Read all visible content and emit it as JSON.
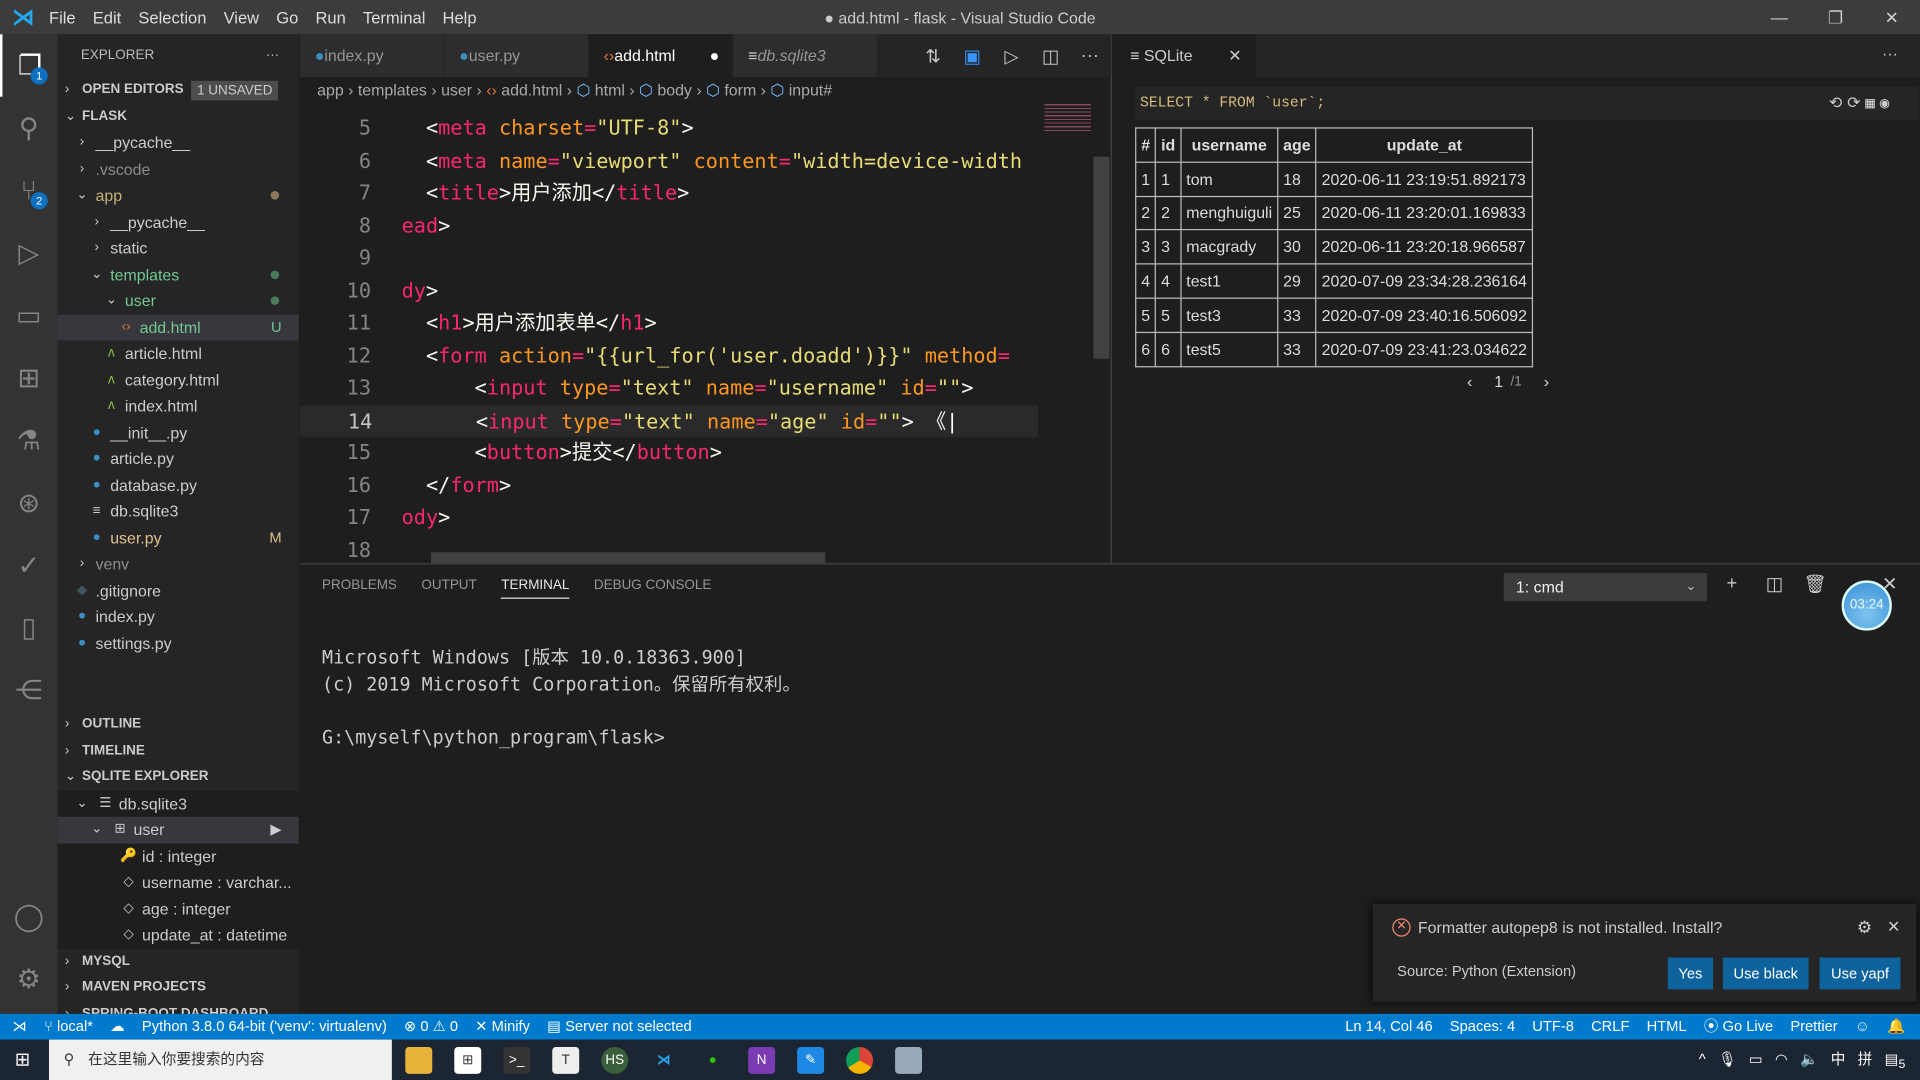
{
  "titlebar": {
    "menu": [
      "File",
      "Edit",
      "Selection",
      "View",
      "Go",
      "Run",
      "Terminal",
      "Help"
    ],
    "title": "● add.html - flask - Visual Studio Code",
    "min": "—",
    "max": "❐",
    "close": "✕"
  },
  "activity": {
    "explorer_badge": "1",
    "scm_badge": "2"
  },
  "sidebar": {
    "title": "EXPLORER",
    "more": "···",
    "open_editors": "OPEN EDITORS",
    "unsaved": "1 UNSAVED",
    "root": "FLASK",
    "tree": [
      {
        "label": "__pycache__",
        "indent": 1,
        "chev": "›",
        "color": "#ccc"
      },
      {
        "label": ".vscode",
        "indent": 1,
        "chev": "›",
        "color": "#8c8c8c"
      },
      {
        "label": "app",
        "indent": 1,
        "chev": "⌄",
        "color": "#c5b27a",
        "dot": "#8a7a5a"
      },
      {
        "label": "__pycache__",
        "indent": 2,
        "chev": "›",
        "color": "#ccc"
      },
      {
        "label": "static",
        "indent": 2,
        "chev": "›",
        "color": "#ccc"
      },
      {
        "label": "templates",
        "indent": 2,
        "chev": "⌄",
        "color": "#73c991",
        "dot": "#4b7a5a"
      },
      {
        "label": "user",
        "indent": 3,
        "chev": "⌄",
        "color": "#73c991",
        "dot": "#4b7a5a"
      },
      {
        "label": "add.html",
        "indent": 4,
        "icon": "‹›",
        "iconColor": "#e37933",
        "color": "#73c991",
        "status": "U",
        "sel": true
      },
      {
        "label": "article.html",
        "indent": 3,
        "icon": "ʌ",
        "iconColor": "#8dc149",
        "color": "#ccc"
      },
      {
        "label": "category.html",
        "indent": 3,
        "icon": "ʌ",
        "iconColor": "#8dc149",
        "color": "#ccc"
      },
      {
        "label": "index.html",
        "indent": 3,
        "icon": "ʌ",
        "iconColor": "#8dc149",
        "color": "#ccc"
      },
      {
        "label": "__init__.py",
        "indent": 2,
        "icon": "●",
        "iconColor": "#3b8ec4",
        "color": "#ccc"
      },
      {
        "label": "article.py",
        "indent": 2,
        "icon": "●",
        "iconColor": "#3b8ec4",
        "color": "#ccc"
      },
      {
        "label": "database.py",
        "indent": 2,
        "icon": "●",
        "iconColor": "#3b8ec4",
        "color": "#ccc"
      },
      {
        "label": "db.sqlite3",
        "indent": 2,
        "icon": "≡",
        "iconColor": "#ccc",
        "color": "#ccc"
      },
      {
        "label": "user.py",
        "indent": 2,
        "icon": "●",
        "iconColor": "#3b8ec4",
        "color": "#e2c08d",
        "status": "M"
      },
      {
        "label": "venv",
        "indent": 1,
        "chev": "›",
        "color": "#8c8c8c"
      },
      {
        "label": ".gitignore",
        "indent": 1,
        "icon": "◆",
        "iconColor": "#41535b",
        "color": "#ccc"
      },
      {
        "label": "index.py",
        "indent": 1,
        "icon": "●",
        "iconColor": "#3b8ec4",
        "color": "#ccc"
      },
      {
        "label": "settings.py",
        "indent": 1,
        "icon": "●",
        "iconColor": "#3b8ec4",
        "color": "#ccc"
      }
    ],
    "outline": "OUTLINE",
    "timeline": "TIMELINE",
    "sqlite_explorer": "SQLITE EXPLORER",
    "sqlite_tree": [
      {
        "label": "db.sqlite3",
        "indent": 1,
        "chev": "⌄",
        "icon": "☰"
      },
      {
        "label": "user",
        "indent": 2,
        "chev": "⌄",
        "icon": "⊞",
        "sel": true
      },
      {
        "label": "id : integer",
        "indent": 3,
        "icon": "🔑"
      },
      {
        "label": "username : varchar...",
        "indent": 3,
        "icon": "◇"
      },
      {
        "label": "age : integer",
        "indent": 3,
        "icon": "◇"
      },
      {
        "label": "update_at : datetime",
        "indent": 3,
        "icon": "◇"
      }
    ],
    "mysql": "MYSQL",
    "maven": "MAVEN PROJECTS",
    "spring": "SPRING-BOOT DASHBOARD"
  },
  "editor": {
    "tabs": [
      {
        "label": "index.py",
        "icon": "●",
        "iconColor": "#3b8ec4"
      },
      {
        "label": "user.py",
        "icon": "●",
        "iconColor": "#3b8ec4"
      },
      {
        "label": "add.html",
        "icon": "‹›",
        "iconColor": "#e37933",
        "active": true,
        "dirty": "●"
      },
      {
        "label": "db.sqlite3",
        "icon": "≡",
        "iconColor": "#ccc",
        "italic": true
      }
    ],
    "breadcrumb": [
      "app",
      "templates",
      "user",
      "add.html",
      "html",
      "body",
      "form",
      "input#"
    ],
    "cursor_line": 14,
    "lines": [
      {
        "n": "5",
        "tokens": [
          [
            "  <",
            "p"
          ],
          [
            "meta",
            "t"
          ],
          [
            " charset",
            "a"
          ],
          [
            "=",
            "t"
          ],
          [
            "\"UTF-8\"",
            "s"
          ],
          [
            ">",
            "p"
          ]
        ]
      },
      {
        "n": "6",
        "tokens": [
          [
            "  <",
            "p"
          ],
          [
            "meta",
            "t"
          ],
          [
            " name",
            "a"
          ],
          [
            "=",
            "t"
          ],
          [
            "\"viewport\"",
            "s"
          ],
          [
            " content",
            "a"
          ],
          [
            "=",
            "t"
          ],
          [
            "\"width=device-width",
            "s"
          ]
        ]
      },
      {
        "n": "7",
        "tokens": [
          [
            "  <",
            "p"
          ],
          [
            "title",
            "t"
          ],
          [
            ">用户添加</",
            "p"
          ],
          [
            "title",
            "t"
          ],
          [
            ">",
            "p"
          ]
        ]
      },
      {
        "n": "8",
        "tokens": [
          [
            "ead",
            "t"
          ],
          [
            ">",
            "p"
          ]
        ]
      },
      {
        "n": "9",
        "tokens": []
      },
      {
        "n": "10",
        "tokens": [
          [
            "dy",
            "t"
          ],
          [
            ">",
            "p"
          ]
        ]
      },
      {
        "n": "11",
        "tokens": [
          [
            "  <",
            "p"
          ],
          [
            "h1",
            "t"
          ],
          [
            ">用户添加表单</",
            "p"
          ],
          [
            "h1",
            "t"
          ],
          [
            ">",
            "p"
          ]
        ]
      },
      {
        "n": "12",
        "tokens": [
          [
            "  <",
            "p"
          ],
          [
            "form",
            "t"
          ],
          [
            " action",
            "a"
          ],
          [
            "=",
            "t"
          ],
          [
            "\"{{url_for('user.doadd')}}\"",
            "s"
          ],
          [
            " method",
            "a"
          ],
          [
            "=",
            "t"
          ]
        ]
      },
      {
        "n": "13",
        "tokens": [
          [
            "      <",
            "p"
          ],
          [
            "input",
            "t"
          ],
          [
            " type",
            "a"
          ],
          [
            "=",
            "t"
          ],
          [
            "\"text\"",
            "s"
          ],
          [
            " name",
            "a"
          ],
          [
            "=",
            "t"
          ],
          [
            "\"username\"",
            "s"
          ],
          [
            " id",
            "a"
          ],
          [
            "=",
            "t"
          ],
          [
            "\"\"",
            "s"
          ],
          [
            ">",
            "p"
          ]
        ]
      },
      {
        "n": "14",
        "tokens": [
          [
            "      <",
            "p"
          ],
          [
            "input",
            "t"
          ],
          [
            " type",
            "a"
          ],
          [
            "=",
            "t"
          ],
          [
            "\"text\"",
            "s"
          ],
          [
            " name",
            "a"
          ],
          [
            "=",
            "t"
          ],
          [
            "\"age\"",
            "s"
          ],
          [
            " id",
            "a"
          ],
          [
            "=",
            "t"
          ],
          [
            "\"\"",
            "s"
          ],
          [
            ">",
            "p"
          ],
          [
            " 《",
            "w"
          ]
        ]
      },
      {
        "n": "15",
        "tokens": [
          [
            "      <",
            "p"
          ],
          [
            "button",
            "t"
          ],
          [
            ">提交</",
            "p"
          ],
          [
            "button",
            "t"
          ],
          [
            ">",
            "p"
          ]
        ]
      },
      {
        "n": "16",
        "tokens": [
          [
            "  </",
            "p"
          ],
          [
            "form",
            "t"
          ],
          [
            ">",
            "p"
          ]
        ]
      },
      {
        "n": "17",
        "tokens": [
          [
            "ody",
            "t"
          ],
          [
            ">",
            "p"
          ]
        ]
      },
      {
        "n": "18",
        "tokens": []
      }
    ]
  },
  "sqlite": {
    "tab": "SQLite",
    "query": "SELECT * FROM `user`;",
    "columns": [
      "#",
      "id",
      "username",
      "age",
      "update_at"
    ],
    "rows": [
      [
        "1",
        "1",
        "tom",
        "18",
        "2020-06-11 23:19:51.892173"
      ],
      [
        "2",
        "2",
        "menghuiguli",
        "25",
        "2020-06-11 23:20:01.169833"
      ],
      [
        "3",
        "3",
        "macgrady",
        "30",
        "2020-06-11 23:20:18.966587"
      ],
      [
        "4",
        "4",
        "test1",
        "29",
        "2020-07-09 23:34:28.236164"
      ],
      [
        "5",
        "5",
        "test3",
        "33",
        "2020-07-09 23:40:16.506092"
      ],
      [
        "6",
        "6",
        "test5",
        "33",
        "2020-07-09 23:41:23.034622"
      ]
    ],
    "page": "1",
    "pages": "/1"
  },
  "panel": {
    "tabs": [
      "PROBLEMS",
      "OUTPUT",
      "TERMINAL",
      "DEBUG CONSOLE"
    ],
    "active": "TERMINAL",
    "terminal_select": "1: cmd",
    "terminal": "Microsoft Windows [版本 10.0.18363.900]\n(c) 2019 Microsoft Corporation。保留所有权利。\n\nG:\\myself\\python_program\\flask>"
  },
  "timer": "03:24",
  "toast": {
    "message": "Formatter autopep8 is not installed. Install?",
    "source": "Source: Python (Extension)",
    "buttons": [
      "Yes",
      "Use black",
      "Use yapf"
    ]
  },
  "status": {
    "left": [
      "local*",
      "Python 3.8.0 64-bit ('venv': virtualenv)",
      "⊗ 0 ⚠ 0",
      "Minify",
      "Server not selected"
    ],
    "right": [
      "Ln 14, Col 46",
      "Spaces: 4",
      "UTF-8",
      "CRLF",
      "HTML",
      "Go Live",
      "Prettier"
    ]
  },
  "taskbar": {
    "search": "在这里输入你要搜索的内容",
    "ime": "中",
    "ime2": "拼",
    "notifications": "5"
  }
}
